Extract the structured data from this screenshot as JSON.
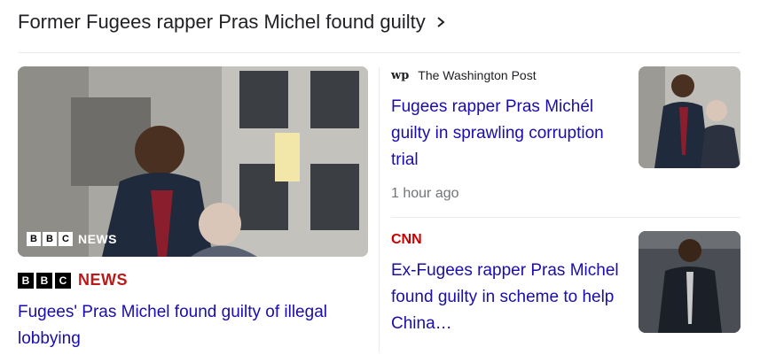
{
  "section": {
    "title": "Former Fugees rapper Pras Michel found guilty"
  },
  "main_story": {
    "image_overlay": {
      "letters": [
        "B",
        "B",
        "C"
      ],
      "word": "NEWS"
    },
    "source_logo": {
      "letters": [
        "B",
        "B",
        "C"
      ],
      "word": "NEWS"
    },
    "headline": "Fugees' Pras Michel found guilty of illegal lobbying"
  },
  "story_2": {
    "source_icon": "wp",
    "source": "The Washington Post",
    "headline": "Fugees rapper Pras Michél guilty in sprawling corruption trial",
    "time": "1 hour ago"
  },
  "story_3": {
    "source_logo": "CNN",
    "headline": "Ex-Fugees rapper Pras Michel found guilty in scheme to help China…"
  },
  "colors": {
    "link": "#1a0dab",
    "bbc_red": "#bb1919",
    "cnn_red": "#cc0000",
    "meta_gray": "#70757a"
  }
}
